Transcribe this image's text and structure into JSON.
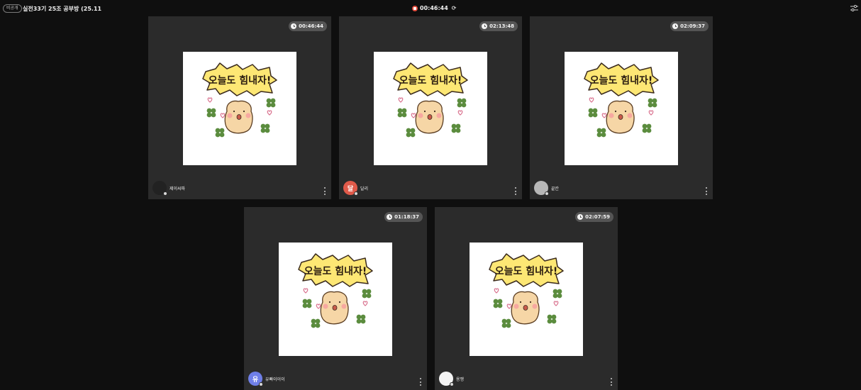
{
  "header": {
    "visibility_badge": "비공개",
    "room_title": "실전33기 25조 공부방 (25.11",
    "session_timer": "00:46:44",
    "icons": {
      "record": "record-icon",
      "refresh": "refresh-icon",
      "settings": "sliders-icon"
    }
  },
  "sticker_text": "오늘도 힘내자!",
  "participants": [
    {
      "name": "제이씨파",
      "timer": "00:46:44",
      "avatar_initial": "",
      "avatar_color": "#222222"
    },
    {
      "name": "달리",
      "timer": "02:13:48",
      "avatar_initial": "달",
      "avatar_color": "#e05a4a"
    },
    {
      "name": "끝칸",
      "timer": "02:09:37",
      "avatar_initial": "",
      "avatar_color": "#b7b7b7"
    },
    {
      "name": "유빠이이이",
      "timer": "01:18:37",
      "avatar_initial": "유",
      "avatar_color": "#6f7fe8"
    },
    {
      "name": "용맹",
      "timer": "02:07:59",
      "avatar_initial": "",
      "avatar_color": "#f4f4f4"
    }
  ],
  "colors": {
    "background": "#0f0f0f",
    "tile": "#2b2b2b",
    "timer_pill": "#555555",
    "record": "#e2493a"
  }
}
